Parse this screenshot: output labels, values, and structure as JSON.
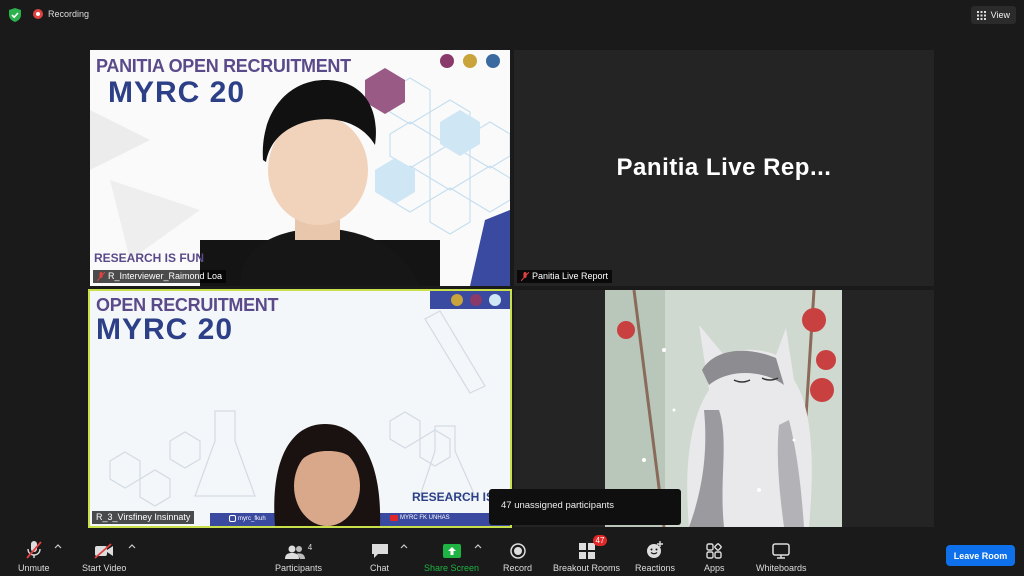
{
  "topbar": {
    "recording_label": "Recording",
    "view_label": "View"
  },
  "tiles": [
    {
      "participant": "R_Interviewer_Raimond Loa",
      "banner_line1": "PANITIA OPEN RECRUITMENT",
      "banner_line2": "MYRC 20",
      "banner_footer": "RESEARCH IS FUN"
    },
    {
      "participant": "Panitia Live Report",
      "display_name": "Panitia  Live  Rep..."
    },
    {
      "participant": "R_3_Virsfiney Insinnaty",
      "banner_line1": "OPEN RECRUITMENT",
      "banner_line2": "MYRC 20",
      "banner_footer": "RESEARCH IS F",
      "social_handle": "myrc_fkuh",
      "youtube_label": "MYRC FK UNHAS"
    },
    {
      "participant": ""
    }
  ],
  "tooltip": {
    "text": "47 unassigned participants"
  },
  "toolbar": {
    "unmute": "Unmute",
    "start_video": "Start Video",
    "participants": "Participants",
    "participants_count": "4",
    "chat": "Chat",
    "share_screen": "Share Screen",
    "record": "Record",
    "breakout_rooms": "Breakout Rooms",
    "breakout_badge": "47",
    "reactions": "Reactions",
    "apps": "Apps",
    "whiteboards": "Whiteboards",
    "leave_room": "Leave Room"
  },
  "colors": {
    "accent_blue": "#0e71eb",
    "share_green": "#1fb344",
    "badge_red": "#e02828",
    "active_speaker_border": "#c9e04a"
  }
}
